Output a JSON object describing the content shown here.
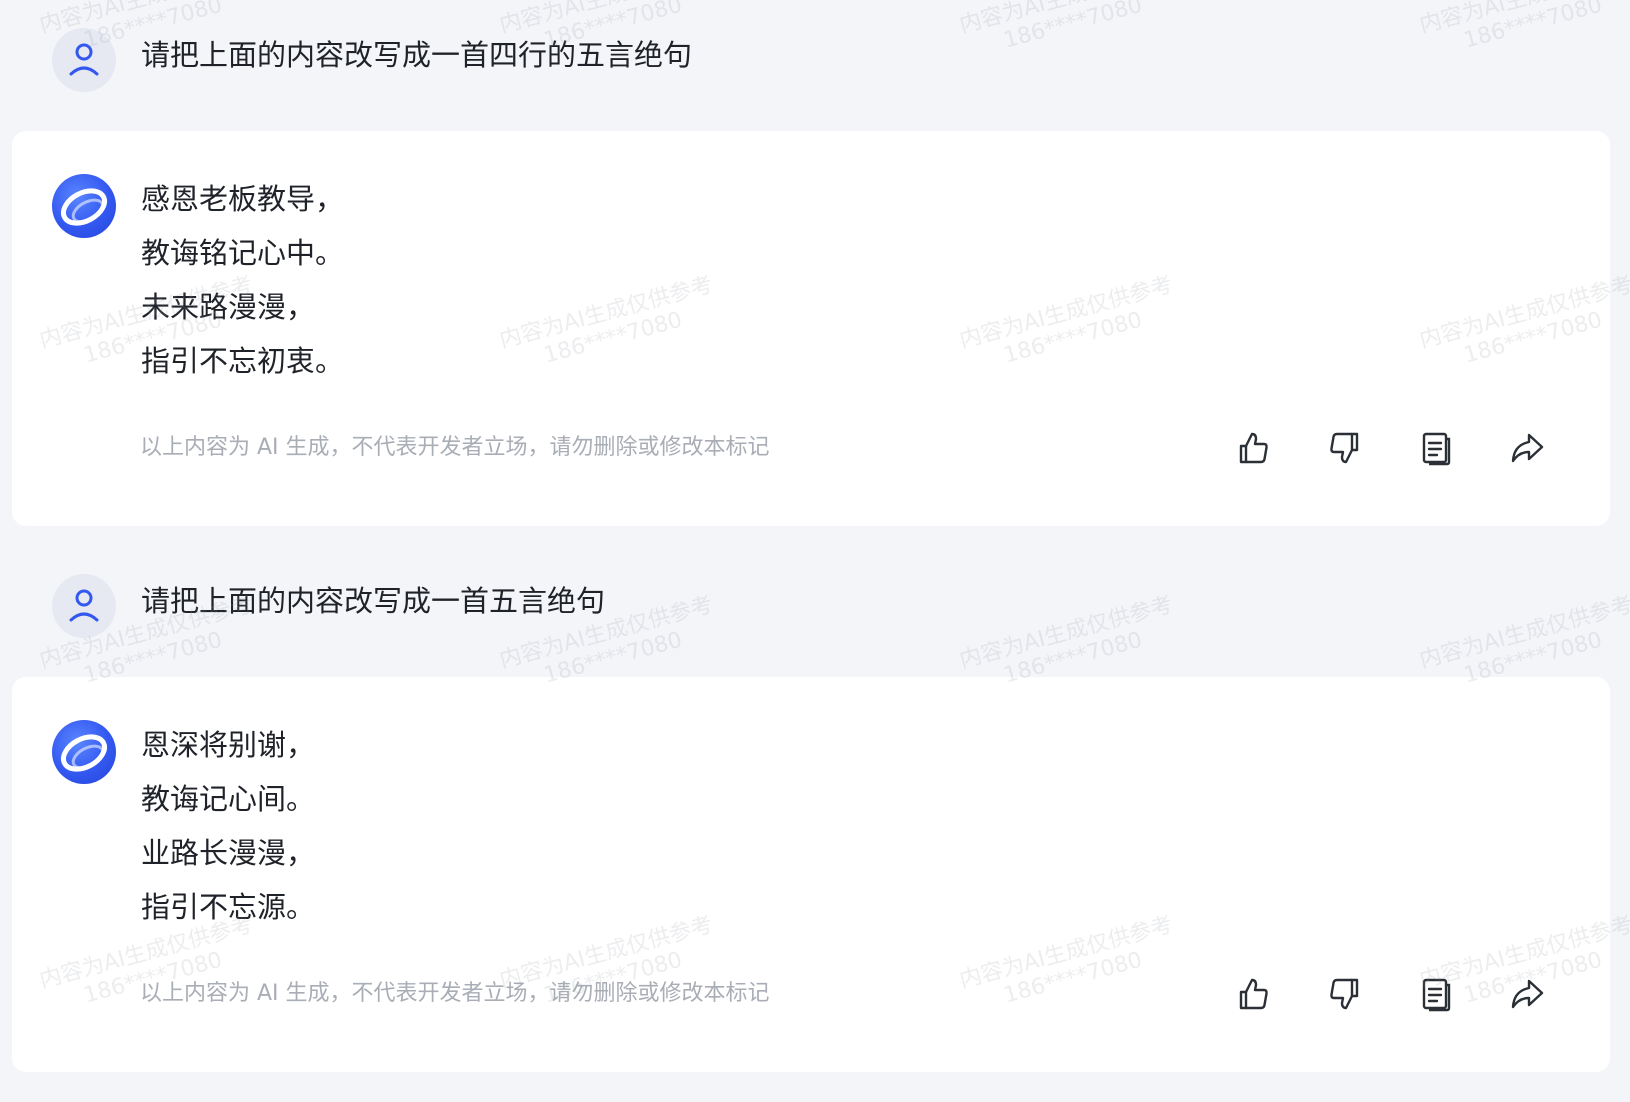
{
  "conversation": [
    {
      "user_message": "请把上面的内容改写成一首四行的五言绝句",
      "assistant": {
        "lines": [
          "感恩老板教导，",
          "教诲铭记心中。",
          "未来路漫漫，",
          "指引不忘初衷。"
        ],
        "disclaimer": "以上内容为 AI 生成，不代表开发者立场，请勿删除或修改本标记"
      }
    },
    {
      "user_message": "请把上面的内容改写成一首五言绝句",
      "assistant": {
        "lines": [
          "恩深将别谢，",
          "教诲记心间。",
          "业路长漫漫，",
          "指引不忘源。"
        ],
        "disclaimer": "以上内容为 AI 生成，不代表开发者立场，请勿删除或修改本标记"
      }
    }
  ],
  "watermark": {
    "line1": "内容为AI生成仅供参考",
    "line2": "186****7080"
  },
  "icons": {
    "user_avatar": "user-icon",
    "bot_avatar": "assistant-logo-icon",
    "actions": [
      "thumbs-up-icon",
      "thumbs-down-icon",
      "copy-icon",
      "share-icon"
    ]
  },
  "colors": {
    "accent": "#3358f0",
    "page_bg": "#f4f5f8",
    "card_bg": "#ffffff",
    "muted_text": "#a9adb5"
  }
}
